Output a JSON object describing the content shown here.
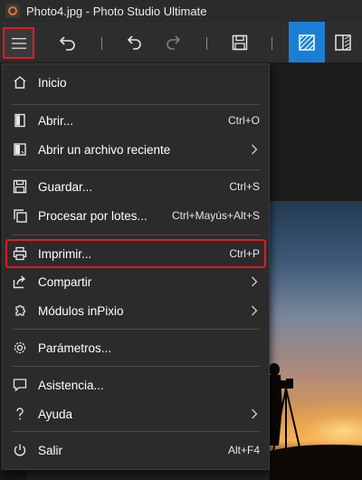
{
  "window": {
    "title": "Photo4.jpg - Photo Studio Ultimate"
  },
  "toolbar": {
    "buttons": [
      {
        "name": "menu",
        "icon": "hamburger-icon"
      },
      {
        "name": "back",
        "icon": "back-arrow-icon"
      },
      {
        "name": "undo",
        "icon": "undo-icon"
      },
      {
        "name": "redo",
        "icon": "redo-icon"
      },
      {
        "name": "save",
        "icon": "save-icon"
      },
      {
        "name": "view-single",
        "icon": "hatched-square-icon",
        "active": true
      },
      {
        "name": "view-compare",
        "icon": "compare-icon"
      }
    ],
    "active_color": "#1a7fd4",
    "highlight_color": "#e11b22"
  },
  "menu": {
    "items": [
      {
        "label": "Inicio",
        "shortcut": "",
        "icon": "home-icon"
      },
      {
        "label": "Abrir...",
        "shortcut": "Ctrl+O",
        "icon": "open-icon"
      },
      {
        "label": "Abrir un archivo reciente",
        "shortcut": "",
        "icon": "recent-files-icon",
        "submenu": true
      },
      {
        "label": "Guardar...",
        "shortcut": "Ctrl+S",
        "icon": "save-icon"
      },
      {
        "label": "Procesar por lotes...",
        "shortcut": "Ctrl+Mayús+Alt+S",
        "icon": "batch-icon"
      },
      {
        "label": "Imprimir...",
        "shortcut": "Ctrl+P",
        "icon": "printer-icon",
        "highlighted": true
      },
      {
        "label": "Compartir",
        "shortcut": "",
        "icon": "share-icon",
        "submenu": true
      },
      {
        "label": "Módulos inPixio",
        "shortcut": "",
        "icon": "puzzle-icon",
        "submenu": true
      },
      {
        "label": "Parámetros...",
        "shortcut": "",
        "icon": "gear-icon"
      },
      {
        "label": "Asistencia...",
        "shortcut": "",
        "icon": "chat-icon"
      },
      {
        "label": "Ayuda",
        "shortcut": "",
        "icon": "question-icon",
        "submenu": true
      },
      {
        "label": "Salir",
        "shortcut": "Alt+F4",
        "icon": "power-icon"
      }
    ]
  }
}
